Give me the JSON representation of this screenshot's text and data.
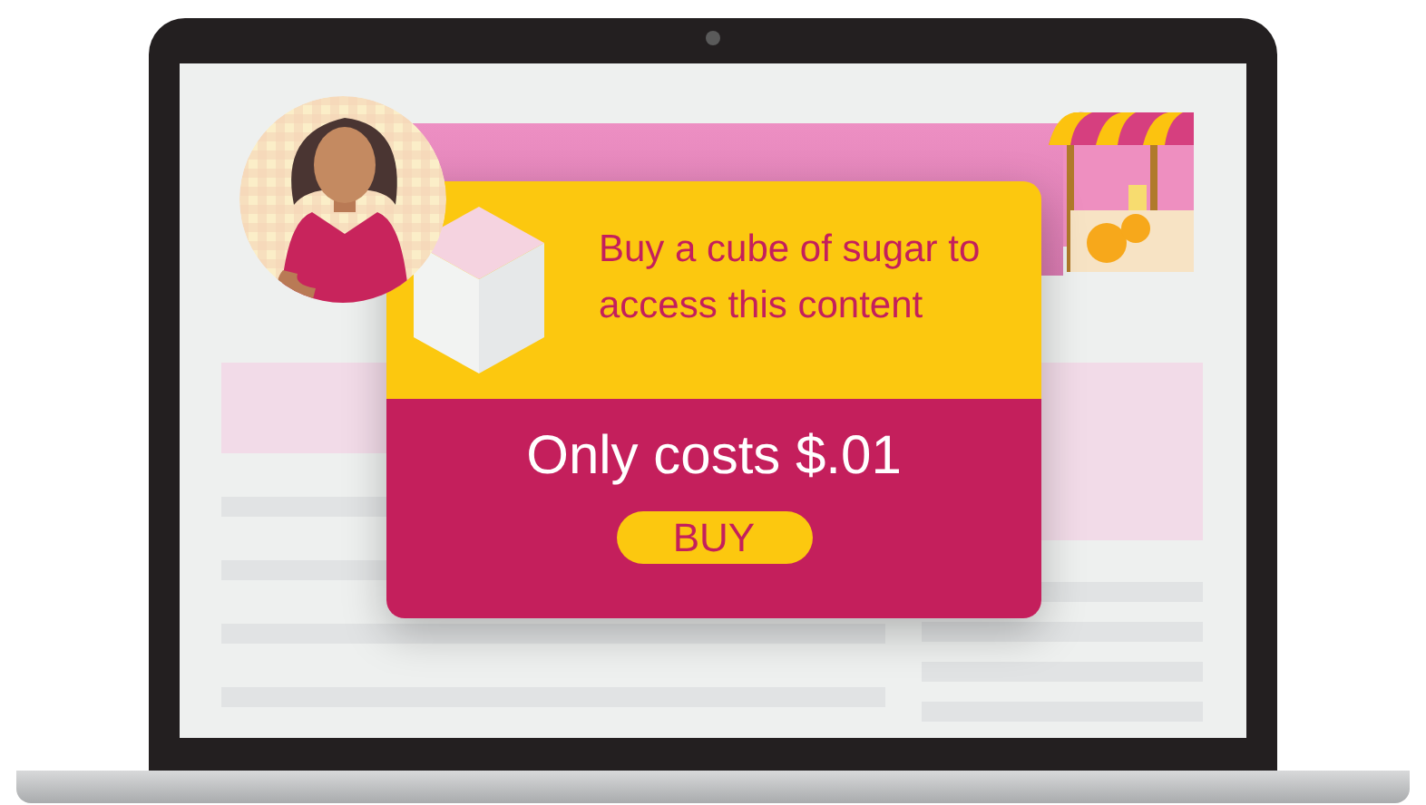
{
  "popup": {
    "message": "Buy a cube of sugar to access this content",
    "price": "Only costs $.01",
    "button": "BUY"
  }
}
